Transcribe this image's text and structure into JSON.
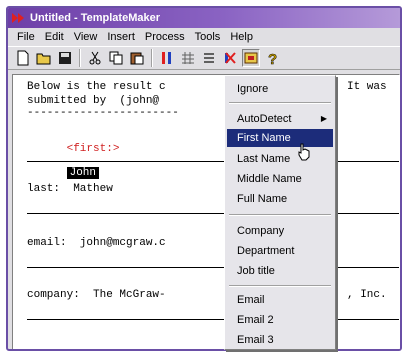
{
  "window": {
    "title": "Untitled - TemplateMaker",
    "accent": "#6d3fa7"
  },
  "menubar": {
    "items": [
      "File",
      "Edit",
      "View",
      "Insert",
      "Process",
      "Tools",
      "Help"
    ]
  },
  "toolbar": {
    "icons": [
      "new-document-icon",
      "open-folder-icon",
      "save-icon",
      "cut-icon",
      "copy-icon",
      "paste-icon",
      "field-marker-icon",
      "grid-icon",
      "list-icon",
      "remove-field-icon",
      "template-icon",
      "help-icon"
    ]
  },
  "document": {
    "line1": "Below is the result c",
    "line1_tail": "It was",
    "line2": "submitted by  (john@",
    "dashes": "-----------------------",
    "first_tag": "<first:>",
    "first_value": "John",
    "last_label": "last:  Mathew",
    "email_label": "email:  john@mcgraw.c",
    "company_label": "company:  The McGraw-",
    "company_tail": ", Inc."
  },
  "context_menu": {
    "ignore": "Ignore",
    "autodetect": "AutoDetect",
    "first_name": "First Name",
    "last_name": "Last Name",
    "middle_name": "Middle Name",
    "full_name": "Full Name",
    "company": "Company",
    "department": "Department",
    "job_title": "Job title",
    "email": "Email",
    "email2": "Email 2",
    "email3": "Email 3",
    "highlight_color": "#1c2c7a"
  }
}
